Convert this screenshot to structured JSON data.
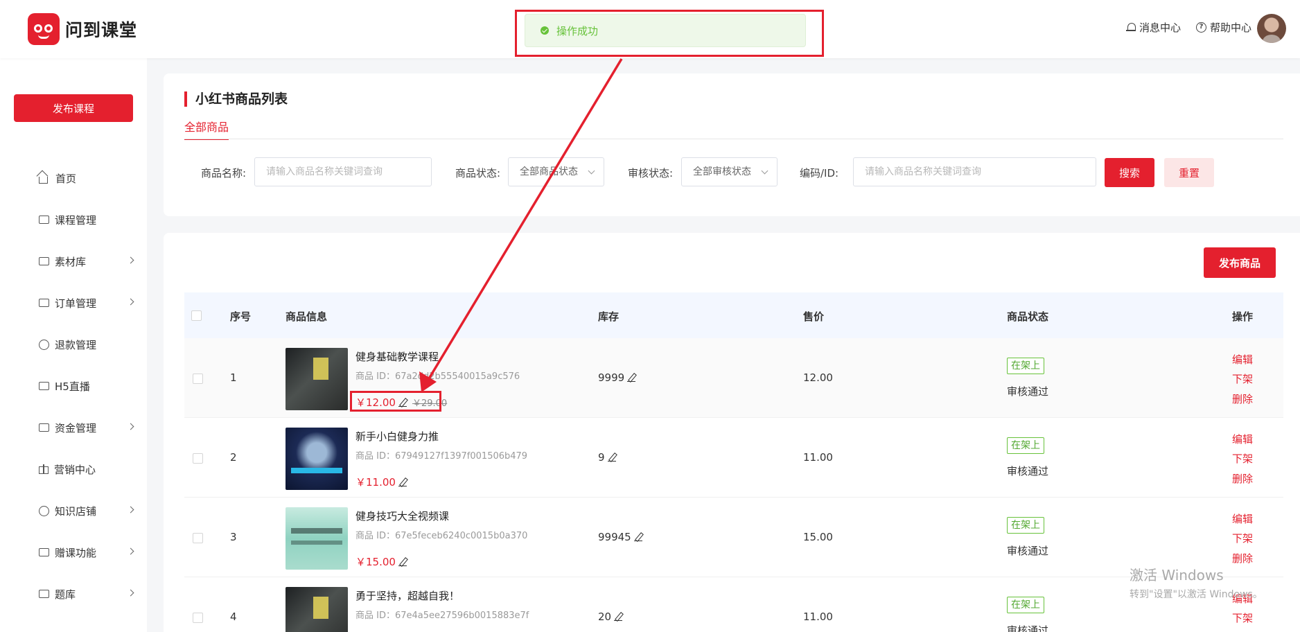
{
  "header": {
    "logo_text": "问到课堂",
    "message_center": "消息中心",
    "help_center": "帮助中心"
  },
  "toast": {
    "text": "操作成功"
  },
  "sidebar": {
    "publish_course": "发布课程",
    "items": [
      {
        "label": "首页",
        "icon": "home-icon"
      },
      {
        "label": "课程管理",
        "icon": "course-icon"
      },
      {
        "label": "素材库",
        "icon": "folder-icon"
      },
      {
        "label": "订单管理",
        "icon": "order-icon"
      },
      {
        "label": "退款管理",
        "icon": "refund-icon"
      },
      {
        "label": "H5直播",
        "icon": "live-icon"
      },
      {
        "label": "资金管理",
        "icon": "wallet-icon"
      },
      {
        "label": "营销中心",
        "icon": "gift-icon"
      },
      {
        "label": "知识店铺",
        "icon": "shop-icon"
      },
      {
        "label": "赠课功能",
        "icon": "gift-course-icon"
      },
      {
        "label": "题库",
        "icon": "question-bank-icon"
      }
    ]
  },
  "page": {
    "title": "小红书商品列表",
    "tab_all": "全部商品"
  },
  "filters": {
    "name_label": "商品名称:",
    "name_placeholder": "请输入商品名称关键词查询",
    "status_label": "商品状态:",
    "status_value": "全部商品状态",
    "audit_label": "审核状态:",
    "audit_value": "全部审核状态",
    "code_label": "编码/ID:",
    "code_placeholder": "请输入商品名称关键词查询",
    "search_button": "搜索",
    "reset_button": "重置"
  },
  "table": {
    "publish_goods": "发布商品",
    "headers": {
      "index": "序号",
      "info": "商品信息",
      "stock": "库存",
      "price": "售价",
      "status": "商品状态",
      "ops": "操作"
    },
    "rows": [
      {
        "index": "1",
        "name": "健身基础教学课程",
        "id": "商品 ID：67a2dd2b55540015a9c576",
        "price": "￥12.00",
        "original_price": "￥29.00",
        "stock": "9999",
        "sale_price": "12.00",
        "status": "在架上",
        "audit": "审核通过",
        "op_edit": "编辑",
        "op_off": "下架",
        "op_delete": "删除"
      },
      {
        "index": "2",
        "name": "新手小白健身力推",
        "id": "商品 ID：67949127f1397f001506b479",
        "price": "￥11.00",
        "stock": "9",
        "sale_price": "11.00",
        "status": "在架上",
        "audit": "审核通过",
        "op_edit": "编辑",
        "op_off": "下架",
        "op_delete": "删除"
      },
      {
        "index": "3",
        "name": "健身技巧大全视频课",
        "id": "商品 ID：67e5feceb6240c0015b0a370",
        "price": "￥15.00",
        "stock": "99945",
        "sale_price": "15.00",
        "status": "在架上",
        "audit": "审核通过",
        "op_edit": "编辑",
        "op_off": "下架",
        "op_delete": "删除"
      },
      {
        "index": "4",
        "name": "勇于坚持，超越自我！",
        "id": "商品 ID：67e4a5ee27596b0015883e7f",
        "stock": "20",
        "sale_price": "11.00",
        "status": "在架上",
        "audit": "审核通过",
        "op_edit": "编辑",
        "op_off": "下架"
      }
    ]
  },
  "watermark": {
    "line1": "激活 Windows",
    "line2": "转到\"设置\"以激活 Windows。"
  },
  "colors": {
    "brand": "#e4202e",
    "success": "#67c23a"
  }
}
